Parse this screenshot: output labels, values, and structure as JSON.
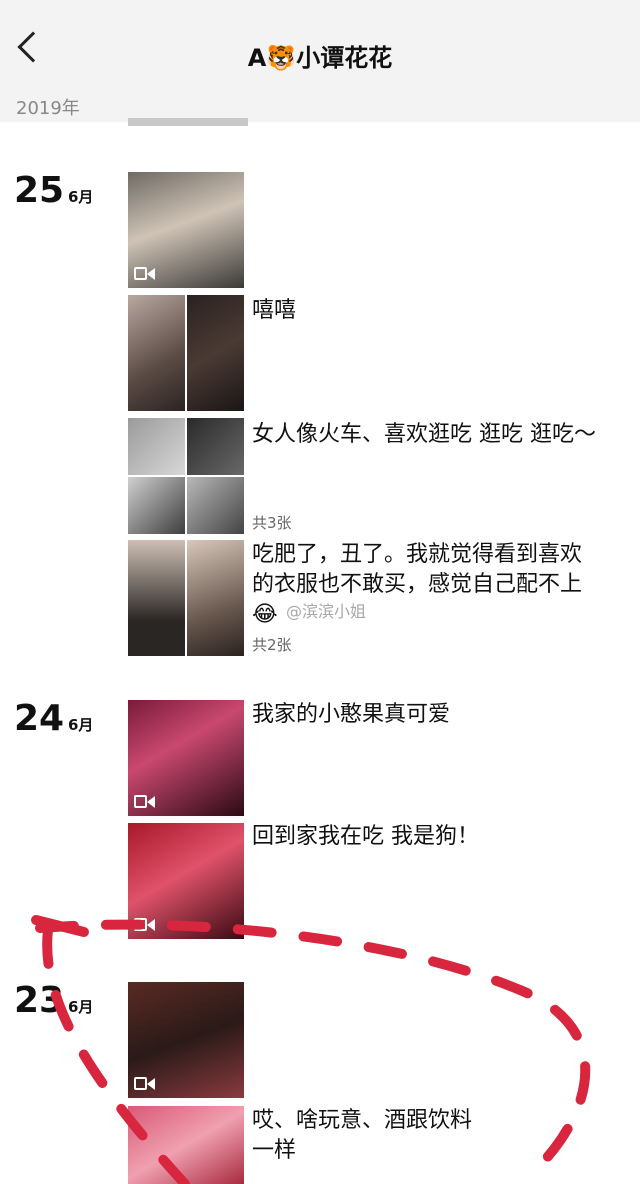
{
  "header": {
    "title": "A🐯小谭花花"
  },
  "year": "2019年",
  "watermark": "@滨滨小姐",
  "days": [
    {
      "day": "25",
      "month": "6月"
    },
    {
      "day": "24",
      "month": "6月"
    },
    {
      "day": "23",
      "month": "6月"
    }
  ],
  "posts": [
    {
      "text": ""
    },
    {
      "text": "嘻嘻"
    },
    {
      "text": "女人像火车、喜欢逛吃 逛吃 逛吃～",
      "count": "共3张"
    },
    {
      "text": "吃肥了，丑了。我就觉得看到喜欢的衣服也不敢买，感觉自己配不上😂",
      "count": "共2张"
    },
    {
      "text": "我家的小憨果真可爱"
    },
    {
      "text": "回到家我在吃 我是狗！"
    },
    {
      "text": ""
    },
    {
      "text": "哎、啥玩意、酒跟饮料一样"
    }
  ],
  "colors": {
    "annotation": "#d9263f",
    "header_bg": "#f3f3f3"
  }
}
